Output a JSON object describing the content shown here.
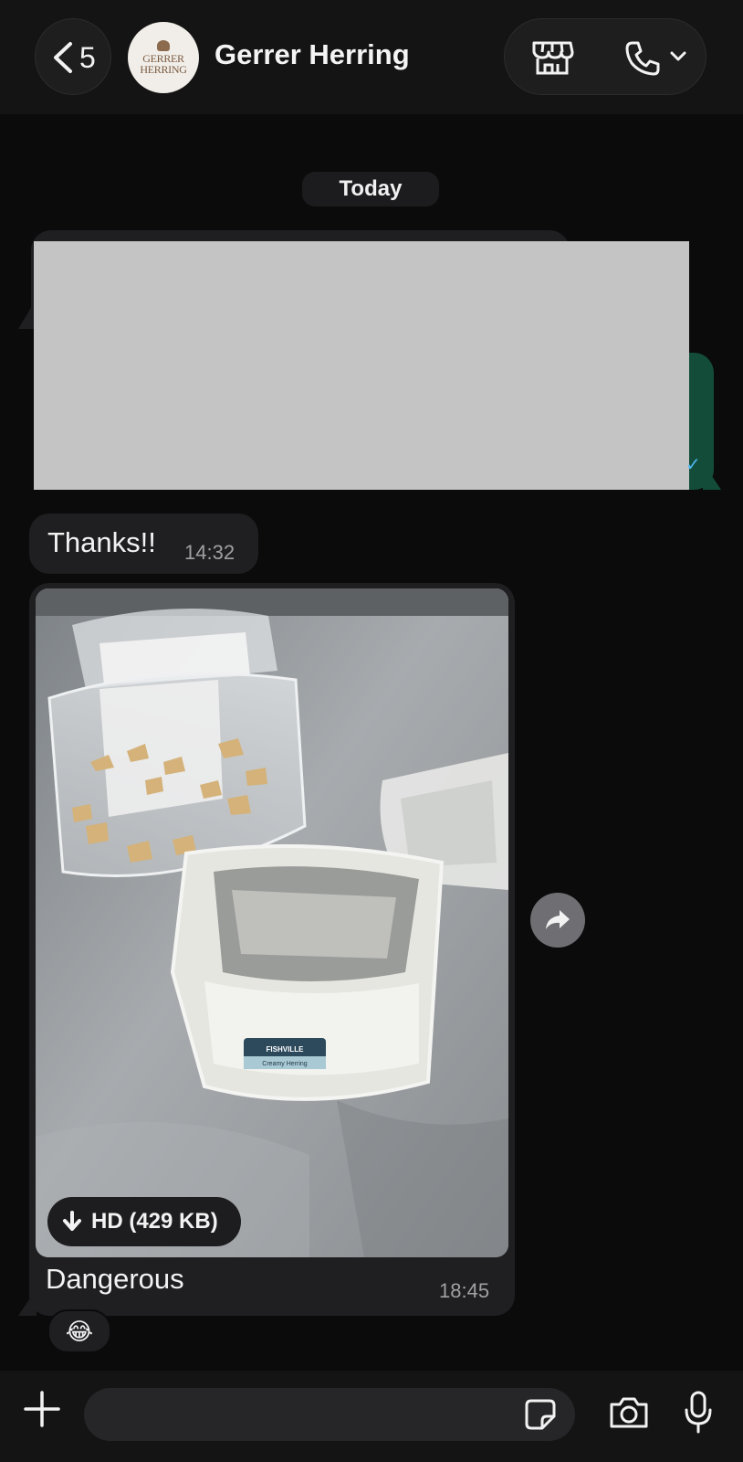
{
  "header": {
    "back_count": "5",
    "avatar_logo_line1": "GERRER",
    "avatar_logo_line2": "HERRING",
    "contact_name": "Gerrer Herring",
    "icons": [
      "chevron-left-icon",
      "storefront-icon",
      "phone-icon",
      "chevron-down-icon"
    ]
  },
  "chat": {
    "date_chip": "Today",
    "messages": [
      {
        "id": "redacted",
        "direction": "mixed",
        "redacted": true
      },
      {
        "id": "thanks",
        "direction": "incoming",
        "text": "Thanks!!",
        "time": "14:32"
      },
      {
        "id": "image-message",
        "direction": "incoming",
        "type": "image",
        "hd_label": "HD (429 KB)",
        "caption": "Dangerous",
        "time": "18:45",
        "reaction": "😂",
        "photo_label_brand": "FISHVILLE",
        "photo_label_product": "Creamy Herring"
      }
    ]
  },
  "composer": {
    "placeholder": "",
    "icons": [
      "plus-icon",
      "sticker-icon",
      "camera-icon",
      "microphone-icon"
    ]
  },
  "colors": {
    "background": "#0b0b0c",
    "incoming_bubble": "#1f1f21",
    "outgoing_bubble": "#134d3a",
    "accent_read": "#4fb6f0"
  }
}
